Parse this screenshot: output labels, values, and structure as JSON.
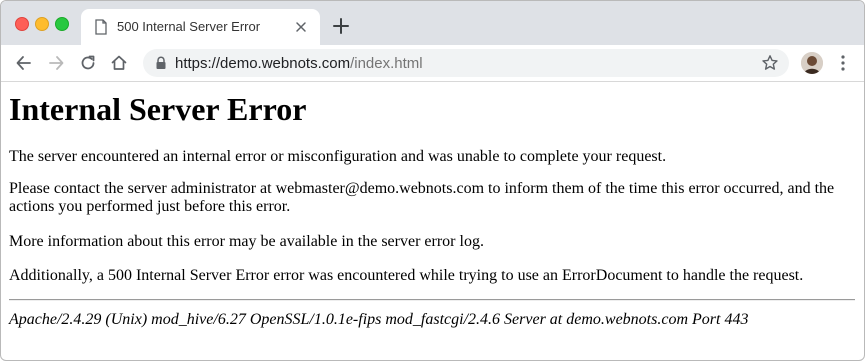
{
  "browser": {
    "tab_title": "500 Internal Server Error",
    "url_host": "https://demo.webnots.com",
    "url_path": "/index.html"
  },
  "icons": {
    "traffic_close": "close-window-icon",
    "traffic_min": "minimize-window-icon",
    "traffic_max": "maximize-window-icon",
    "tab_page": "page-icon",
    "tab_close": "close-icon",
    "new_tab": "plus-icon",
    "back": "back-arrow-icon",
    "forward": "forward-arrow-icon",
    "reload": "reload-icon",
    "home": "home-icon",
    "lock": "lock-icon",
    "bookmark": "star-icon",
    "profile": "avatar",
    "menu": "kebab-menu-icon"
  },
  "colors": {
    "titlebar_bg": "#dee1e6",
    "omnibox_bg": "#f1f3f4",
    "close": "#fe5f57",
    "minimize": "#febc2e",
    "maximize": "#28c840"
  },
  "page": {
    "heading": "Internal Server Error",
    "paragraphs": [
      "The server encountered an internal error or misconfiguration and was unable to complete your request.",
      "Please contact the server administrator at webmaster@demo.webnots.com to inform them of the time this error occurred, and the actions you performed just before this error.",
      "More information about this error may be available in the server error log.",
      "Additionally, a 500 Internal Server Error error was encountered while trying to use an ErrorDocument to handle the request."
    ],
    "address": "Apache/2.4.29 (Unix) mod_hive/6.27 OpenSSL/1.0.1e-fips mod_fastcgi/2.4.6 Server at demo.webnots.com Port 443"
  }
}
